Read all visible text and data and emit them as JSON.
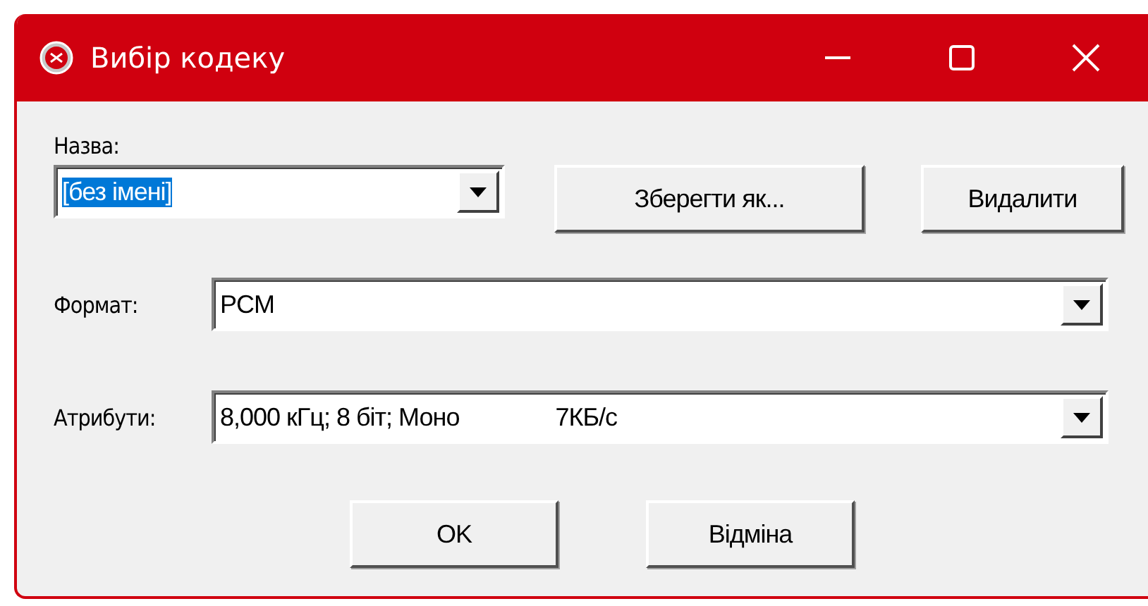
{
  "window": {
    "title": "Вибір кодеку"
  },
  "name": {
    "label": "Назва:",
    "value": "[без імені]",
    "value_selected": true
  },
  "buttons_top": [
    {
      "label": "Зберегти як..."
    },
    {
      "label": "Видалити"
    }
  ],
  "format": {
    "label": "Формат:",
    "value": "PCM"
  },
  "attributes": {
    "label": "Атрибути:",
    "value": "8,000 кГц; 8 біт; Моно",
    "rate": "7КБ/с"
  },
  "buttons_bottom": [
    {
      "label": "OK"
    },
    {
      "label": "Відміна"
    }
  ]
}
